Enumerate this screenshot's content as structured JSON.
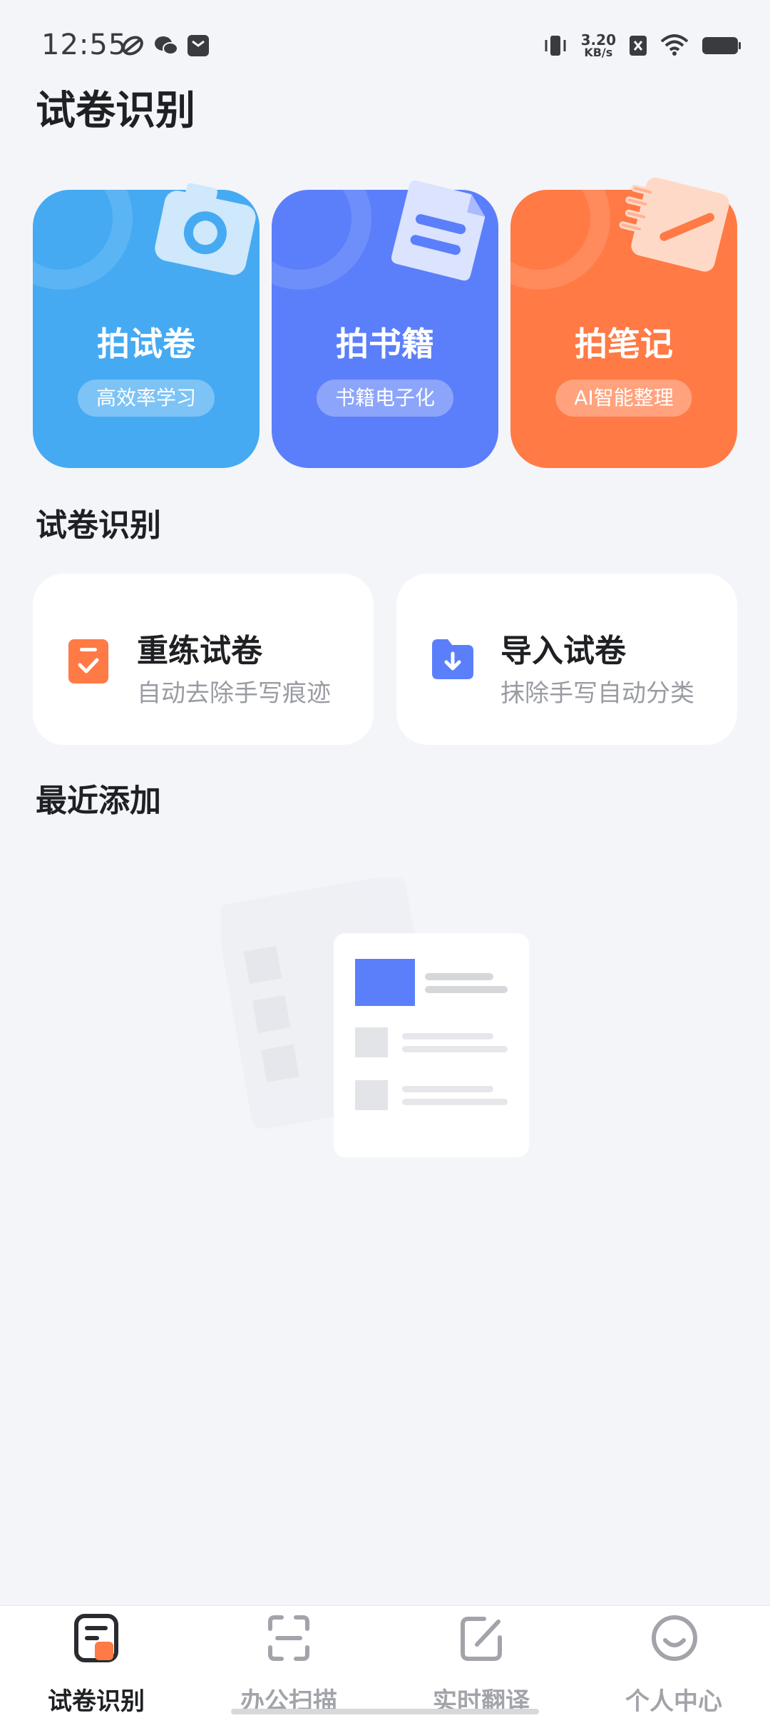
{
  "status_bar": {
    "time": "12:55",
    "net_speed_value": "3.20",
    "net_speed_unit": "KB/s",
    "icons": [
      "app-notification-icon",
      "wechat-icon",
      "message-icon",
      "vibrate-icon",
      "sim-off-icon",
      "wifi-icon",
      "battery-icon"
    ]
  },
  "page_title": "试卷识别",
  "feature_cards": [
    {
      "title": "拍试卷",
      "tag": "高效率学习",
      "icon": "camera-icon",
      "color": "#45aaf2"
    },
    {
      "title": "拍书籍",
      "tag": "书籍电子化",
      "icon": "document-icon",
      "color": "#5b7ffa"
    },
    {
      "title": "拍笔记",
      "tag": "AI智能整理",
      "icon": "pen-note-icon",
      "color": "#ff7a45"
    }
  ],
  "section_exam": "试卷识别",
  "actions": [
    {
      "title": "重练试卷",
      "subtitle": "自动去除手写痕迹",
      "icon": "clipboard-check-icon",
      "color": "#ff7a45"
    },
    {
      "title": "导入试卷",
      "subtitle": "抹除手写自动分类",
      "icon": "folder-import-icon",
      "color": "#5b7ffa"
    }
  ],
  "section_recent": "最近添加",
  "bottom_nav": [
    {
      "label": "试卷识别",
      "icon": "exam-icon",
      "active": true
    },
    {
      "label": "办公扫描",
      "icon": "scan-icon",
      "active": false
    },
    {
      "label": "实时翻译",
      "icon": "edit-icon",
      "active": false
    },
    {
      "label": "个人中心",
      "icon": "profile-icon",
      "active": false
    }
  ],
  "colors": {
    "accent_blue": "#5b7ffa",
    "accent_orange": "#ff7a45",
    "accent_sky": "#45aaf2",
    "background": "#f4f5f9"
  }
}
